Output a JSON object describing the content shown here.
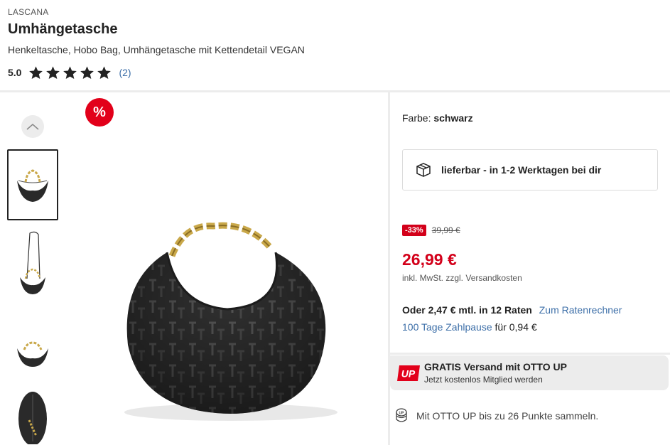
{
  "product": {
    "brand": "LASCANA",
    "title": "Umhängetasche",
    "subtitle": "Henkeltasche, Hobo Bag, Umhängetasche mit Kettendetail VEGAN",
    "rating": "5.0",
    "rating_stars": 5,
    "review_count": "(2)"
  },
  "gallery": {
    "sale_badge": "%",
    "thumbnails": [
      "bag-front",
      "bag-with-strap",
      "bag-small",
      "bag-top-view"
    ],
    "active_thumbnail": 0
  },
  "details": {
    "color_label": "Farbe:",
    "color_value": "schwarz",
    "delivery_text": "lieferbar - in 1-2 Werktagen bei dir",
    "discount_badge": "-33%",
    "old_price": "39,99 €",
    "price": "26,99 €",
    "vat_text": "inkl. MwSt. zzgl.",
    "shipping_link": "Versandkosten",
    "installment_text": "Oder 2,47 € mtl. in 12 Raten",
    "installment_link": "Zum Ratenrechner",
    "paylater_link": "100 Tage Zahlpause",
    "paylater_suffix": "für 0,94 €"
  },
  "otto_up": {
    "logo_text": "UP",
    "title": "GRATIS Versand mit OTTO UP",
    "subtitle": "Jetzt kostenlos Mitglied werden",
    "points_text": "Mit OTTO UP bis zu 26 Punkte sammeln."
  },
  "colors": {
    "accent_red": "#d3001a",
    "link_blue": "#3d6fa8"
  }
}
